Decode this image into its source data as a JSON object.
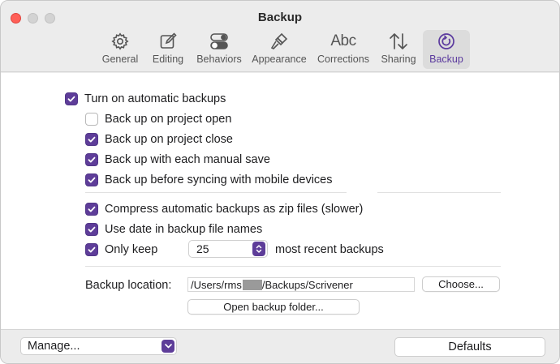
{
  "window": {
    "title": "Backup"
  },
  "toolbar": {
    "tabs": [
      {
        "label": "General",
        "icon": "gear-icon"
      },
      {
        "label": "Editing",
        "icon": "pencil-square-icon"
      },
      {
        "label": "Behaviors",
        "icon": "toggles-icon"
      },
      {
        "label": "Appearance",
        "icon": "paintbrush-icon"
      },
      {
        "label": "Corrections",
        "icon": "abc-text-icon",
        "glyph": "Abc"
      },
      {
        "label": "Sharing",
        "icon": "up-down-arrows-icon"
      },
      {
        "label": "Backup",
        "icon": "backup-arrow-icon",
        "selected": true
      }
    ]
  },
  "options": {
    "auto_backups": {
      "label": "Turn on automatic backups",
      "checked": true
    },
    "on_open": {
      "label": "Back up on project open",
      "checked": false
    },
    "on_close": {
      "label": "Back up on project close",
      "checked": true
    },
    "manual_save": {
      "label": "Back up with each manual save",
      "checked": true
    },
    "before_sync": {
      "label": "Back up before syncing with mobile devices",
      "checked": true
    },
    "compress": {
      "label": "Compress automatic backups as zip files (slower)",
      "checked": true
    },
    "date_names": {
      "label": "Use date in backup file names",
      "checked": true
    },
    "only_keep": {
      "label": "Only keep",
      "checked": true,
      "value": "25",
      "suffix": "most recent backups"
    }
  },
  "location": {
    "label": "Backup location:",
    "path_prefix": "/Users/rms",
    "path_suffix": "/Backups/Scrivener",
    "choose_label": "Choose...",
    "open_folder_label": "Open backup folder..."
  },
  "footer": {
    "manage_label": "Manage...",
    "defaults_label": "Defaults"
  },
  "colors": {
    "accent": "#5e3d99",
    "close": "#ff5f57"
  }
}
